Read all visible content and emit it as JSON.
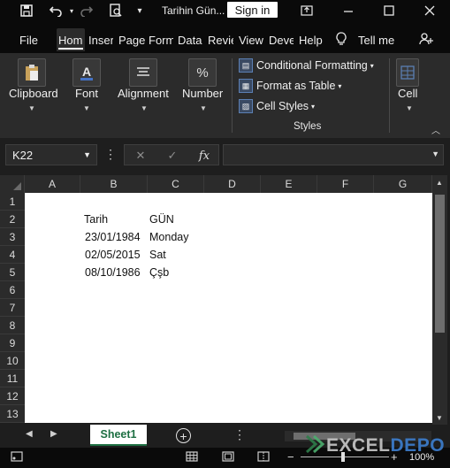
{
  "titlebar": {
    "title": "Tarihin Gün...",
    "signin_label": "Sign in"
  },
  "tabs": [
    {
      "label": "File",
      "active": false
    },
    {
      "label": "Hom",
      "active": true
    },
    {
      "label": "Inser",
      "active": false
    },
    {
      "label": "Page",
      "active": false
    },
    {
      "label": "Form",
      "active": false
    },
    {
      "label": "Data",
      "active": false
    },
    {
      "label": "Revie",
      "active": false
    },
    {
      "label": "View",
      "active": false
    },
    {
      "label": "Deve",
      "active": false
    },
    {
      "label": "Help",
      "active": false
    }
  ],
  "tell_me": "Tell me",
  "ribbon": {
    "clipboard": "Clipboard",
    "font": "Font",
    "alignment": "Alignment",
    "number": "Number",
    "number_icon": "%",
    "conditional_formatting": "Conditional Formatting",
    "format_as_table": "Format as Table",
    "cell_styles": "Cell Styles",
    "styles_group": "Styles",
    "cells": "Cell"
  },
  "formula_bar": {
    "name_box": "K22",
    "fx": "fx",
    "formula": ""
  },
  "columns": [
    "A",
    "B",
    "C",
    "D",
    "E",
    "F",
    "G"
  ],
  "rows": [
    "1",
    "2",
    "3",
    "4",
    "5",
    "6",
    "7",
    "8",
    "9",
    "10",
    "11",
    "12",
    "13"
  ],
  "cells": {
    "B2": "Tarih",
    "C2": "GÜN",
    "B3": "23/01/1984",
    "C3": "Monday",
    "B4": "02/05/2015",
    "C4": "Sat",
    "B5": "08/10/1986",
    "C5": "Çşb"
  },
  "sheet_tab": "Sheet1",
  "zoom": "100%",
  "watermark": {
    "part_a": "EXCEL",
    "part_b": "DEPO"
  }
}
